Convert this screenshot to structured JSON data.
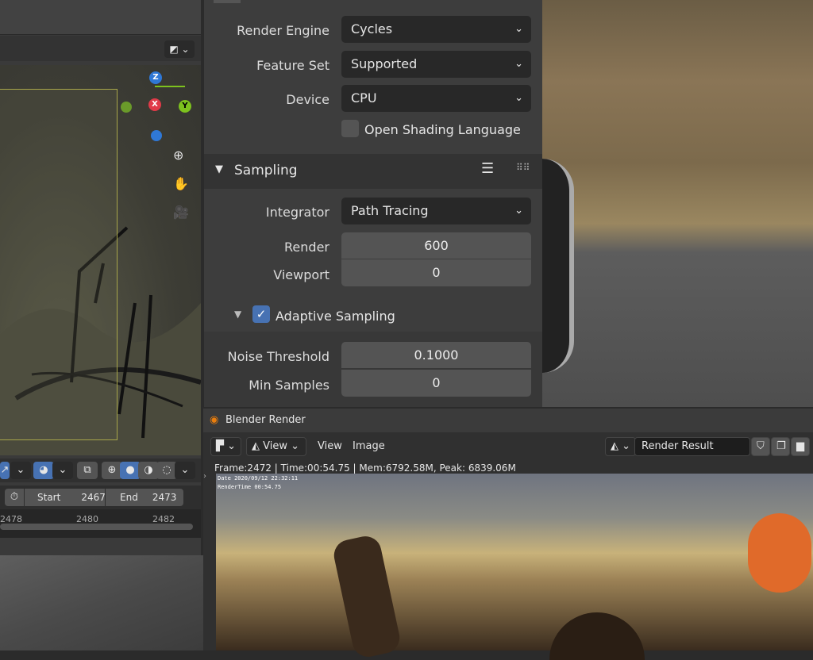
{
  "viewport": {
    "axes": {
      "z": "Z",
      "x": "X",
      "y": "Y"
    }
  },
  "toolbar": {
    "icons": [
      "gizmo-icon",
      "overlay-icon",
      "xray-icon",
      "wireframe-icon",
      "solid-icon",
      "material-icon",
      "rendered-icon"
    ]
  },
  "timeline": {
    "start_label": "Start",
    "start": "2467",
    "end_label": "End",
    "end": "2473",
    "ticks": [
      "2478",
      "2480",
      "2482"
    ]
  },
  "properties": {
    "render_engine_label": "Render Engine",
    "render_engine": "Cycles",
    "feature_set_label": "Feature Set",
    "feature_set": "Supported",
    "device_label": "Device",
    "device": "CPU",
    "osl_label": "Open Shading Language",
    "sampling_title": "Sampling",
    "integrator_label": "Integrator",
    "integrator": "Path Tracing",
    "render_label": "Render",
    "render": "600",
    "viewport_label": "Viewport",
    "viewport": "0",
    "adaptive_label": "Adaptive Sampling",
    "noise_label": "Noise Threshold",
    "noise": "0.1000",
    "min_samples_label": "Min Samples",
    "min_samples": "0"
  },
  "render_window": {
    "title": "Blender Render",
    "view_dropdown": "View",
    "menu_view": "View",
    "menu_image": "Image",
    "image_name": "Render Result",
    "info": "Frame:2472 | Time:00:54.75 | Mem:6792.58M, Peak: 6839.06M",
    "stamp_date": "Date 2020/09/12 22:32:11",
    "stamp_time": "RenderTime 00:54.75"
  },
  "colors": {
    "accent": "#4772b3",
    "x_axis": "#e03a48",
    "y_axis": "#7dc21e",
    "z_axis": "#2f78d6"
  }
}
